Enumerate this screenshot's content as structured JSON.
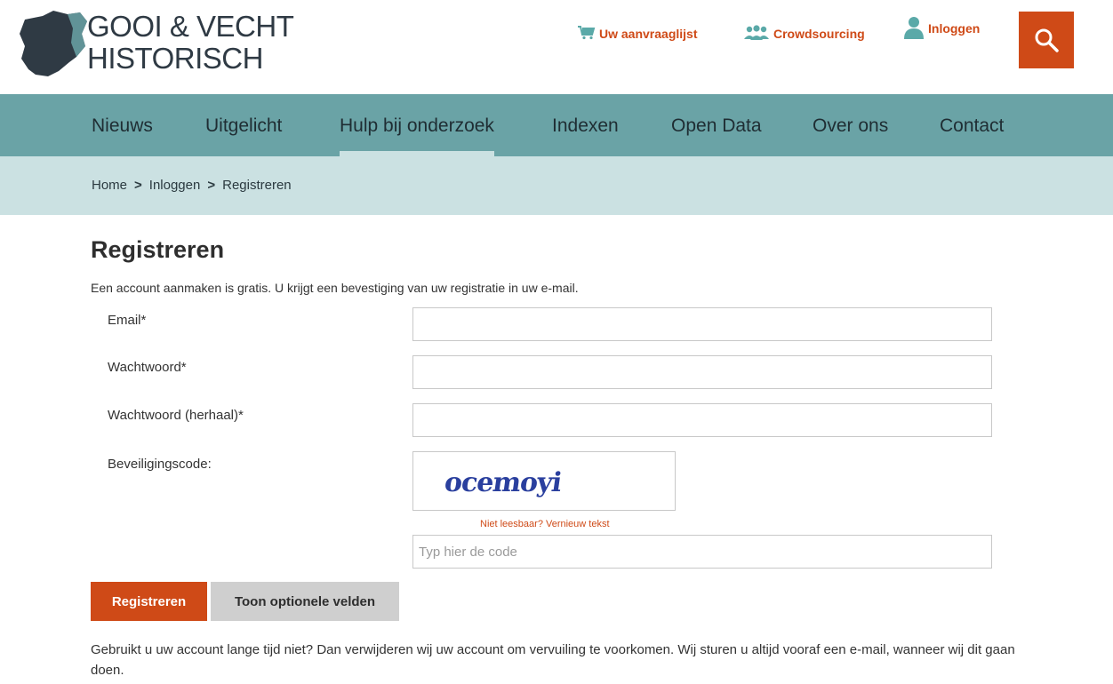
{
  "logo": {
    "line1": "GOOI & VECHT",
    "line2": "HISTORISCH",
    "icon": "region-map-icon",
    "color": "#2f3a44"
  },
  "toplinks": {
    "cart": {
      "label": "Uw aanvraaglijst",
      "icon": "cart-icon"
    },
    "crowd": {
      "label": "Crowdsourcing",
      "icon": "people-icon"
    },
    "login": {
      "label": "Inloggen",
      "icon": "user-icon"
    },
    "search_icon": "search-icon"
  },
  "nav": {
    "items": [
      {
        "label": "Nieuws"
      },
      {
        "label": "Uitgelicht"
      },
      {
        "label": "Hulp bij onderzoek",
        "active": true
      },
      {
        "label": "Indexen"
      },
      {
        "label": "Open Data"
      },
      {
        "label": "Over ons"
      },
      {
        "label": "Contact"
      }
    ]
  },
  "breadcrumb": {
    "items": [
      "Home",
      "Inloggen",
      "Registreren"
    ],
    "separator": ">"
  },
  "page": {
    "title": "Registreren",
    "intro": "Een account aanmaken is gratis. U krijgt een bevestiging van uw registratie in uw e-mail."
  },
  "form": {
    "email_label": "Email*",
    "password_label": "Wachtwoord*",
    "password_repeat_label": "Wachtwoord (herhaal)*",
    "captcha_label": "Beveiligingscode:",
    "captcha_text": "ocemoyi",
    "refresh_link": "Niet leesbaar? Vernieuw tekst",
    "code_placeholder": "Typ hier de code",
    "submit_label": "Registreren",
    "optional_label": "Toon optionele velden"
  },
  "note": "Gebruikt u uw account lange tijd niet? Dan verwijderen wij uw account om vervuiling te voorkomen. Wij sturen u altijd vooraf een e-mail, wanneer wij dit gaan doen.",
  "colors": {
    "accent": "#cf4a17",
    "nav_bg": "#6aa3a6",
    "crumb_bg": "#cbe1e2"
  }
}
